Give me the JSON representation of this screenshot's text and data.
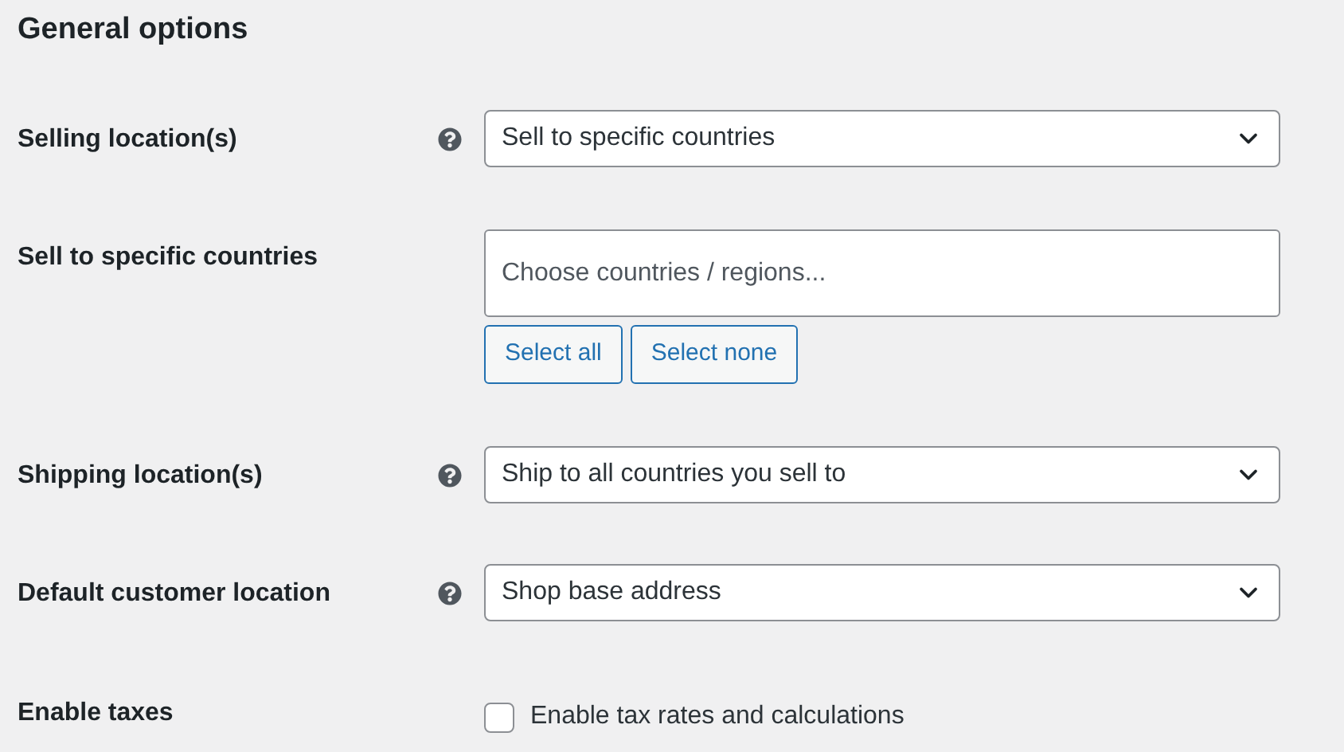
{
  "heading": "General options",
  "rows": [
    {
      "kind": "select",
      "label": "Selling location(s)",
      "help": true,
      "value": "Sell to specific countries"
    },
    {
      "kind": "multiselect",
      "label": "Sell to specific countries",
      "help": false,
      "placeholder": "Choose countries / regions...",
      "buttons": [
        "Select all",
        "Select none"
      ]
    },
    {
      "kind": "select",
      "label": "Shipping location(s)",
      "help": true,
      "value": "Ship to all countries you sell to"
    },
    {
      "kind": "select",
      "label": "Default customer location",
      "help": true,
      "value": "Shop base address"
    },
    {
      "kind": "checkbox",
      "label": "Enable taxes",
      "help": false,
      "checkbox_label": "Enable tax rates and calculations",
      "checked": false
    }
  ]
}
